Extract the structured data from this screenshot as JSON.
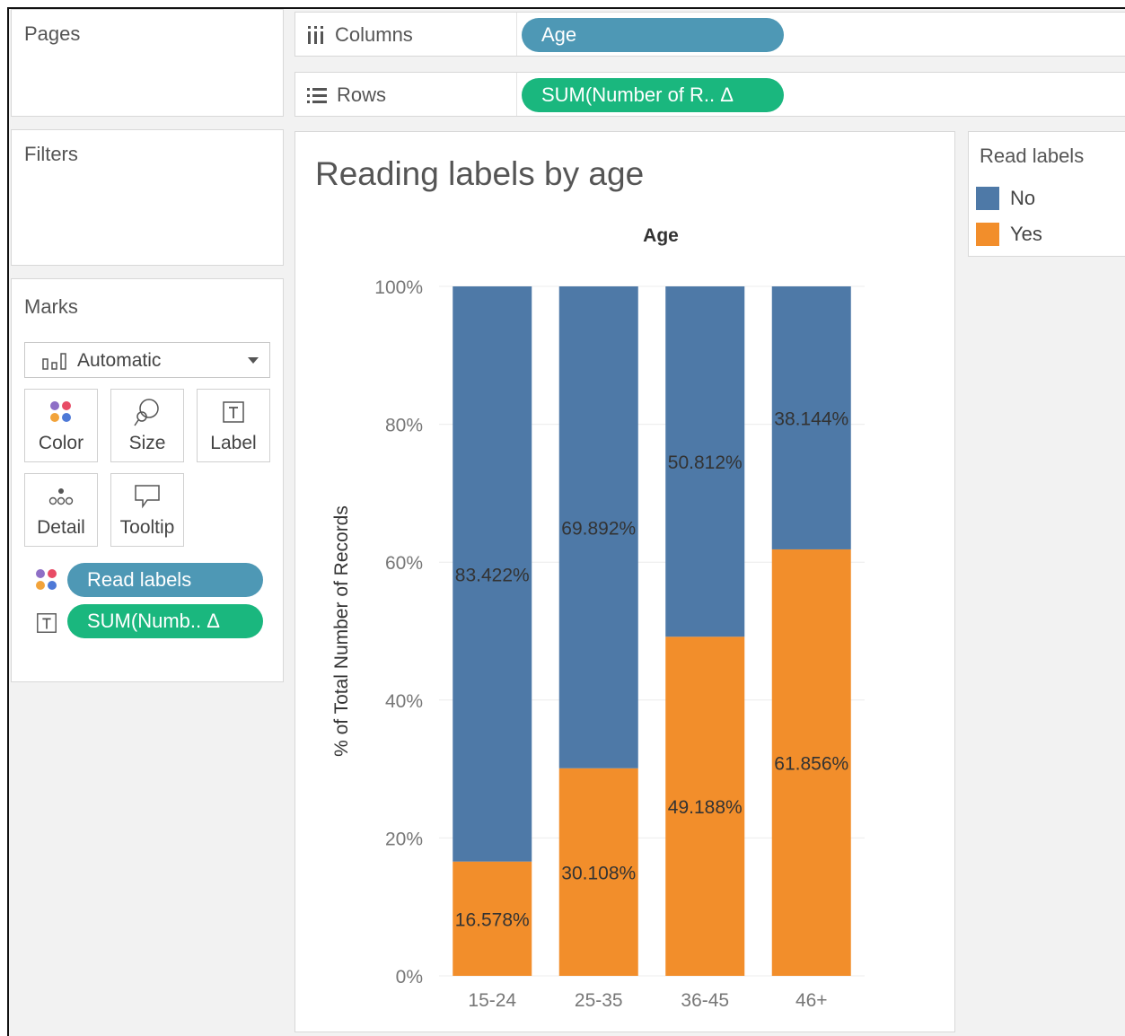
{
  "pages": {
    "title": "Pages"
  },
  "filters": {
    "title": "Filters"
  },
  "marks": {
    "title": "Marks",
    "mark_type": "Automatic",
    "buttons": {
      "color": "Color",
      "size": "Size",
      "label": "Label",
      "detail": "Detail",
      "tooltip": "Tooltip"
    },
    "fields": [
      {
        "label": "Read labels",
        "encoding": "color",
        "color": "#4e98b5"
      },
      {
        "label": "SUM(Numb.. Δ",
        "encoding": "label",
        "color": "#1ab77e"
      }
    ]
  },
  "shelves": {
    "columns": {
      "label": "Columns",
      "pill": "Age"
    },
    "rows": {
      "label": "Rows",
      "pill": "SUM(Number of R.. Δ"
    }
  },
  "legend": {
    "title": "Read labels",
    "items": [
      {
        "label": "No",
        "color": "#4e79a7"
      },
      {
        "label": "Yes",
        "color": "#f28e2b"
      }
    ]
  },
  "chart_data": {
    "type": "bar",
    "stacked": true,
    "title": "Reading labels by age",
    "column_header": "Age",
    "ylabel": "% of Total Number of Records",
    "xlabel": "",
    "categories": [
      "15-24",
      "25-35",
      "36-45",
      "46+"
    ],
    "series": [
      {
        "name": "Yes",
        "color": "#f28e2b",
        "values": [
          16.578,
          30.108,
          49.188,
          61.856
        ],
        "labels": [
          "16.578%",
          "30.108%",
          "49.188%",
          "61.856%"
        ]
      },
      {
        "name": "No",
        "color": "#4e79a7",
        "values": [
          83.422,
          69.892,
          50.812,
          38.144
        ],
        "labels": [
          "83.422%",
          "69.892%",
          "50.812%",
          "38.144%"
        ]
      }
    ],
    "ylim": [
      0,
      100
    ],
    "yticks": [
      "0%",
      "20%",
      "40%",
      "60%",
      "80%",
      "100%"
    ],
    "grid": true
  }
}
